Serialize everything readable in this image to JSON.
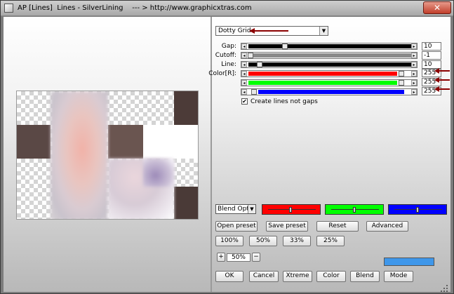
{
  "window": {
    "title": "AP [Lines]  Lines - SilverLining    --- > http://www.graphicxtras.com",
    "close_label": "✕"
  },
  "mode_select": {
    "value": "Dotty Grid"
  },
  "params": [
    {
      "label": "Gap:",
      "value": "10"
    },
    {
      "label": "Cutoff:",
      "value": "-1"
    },
    {
      "label": "Line:",
      "value": "10"
    },
    {
      "label": "Color[R]:",
      "value": "255"
    },
    {
      "label": "",
      "value": "255"
    },
    {
      "label": "",
      "value": "255"
    }
  ],
  "checkbox": {
    "label": "Create lines not gaps",
    "checked": true,
    "mark": "✔"
  },
  "blend": {
    "value": "Blend Opti"
  },
  "buttons": {
    "open_preset": "Open preset",
    "save_preset": "Save preset",
    "reset": "Reset",
    "advanced": "Advanced",
    "zoom100": "100%",
    "zoom50": "50%",
    "zoom33": "33%",
    "zoom25": "25%",
    "plus": "+",
    "minus": "−",
    "ok": "OK",
    "cancel": "Cancel",
    "xtreme": "Xtreme",
    "color": "Color",
    "blend": "Blend",
    "mode": "Mode"
  },
  "zoom": {
    "value": "50%"
  },
  "colors": {
    "red": "#ff0000",
    "green": "#00ff00",
    "blue": "#0000ff",
    "swatch": "#3f97ea",
    "annotation_arrow": "#8b0000"
  }
}
